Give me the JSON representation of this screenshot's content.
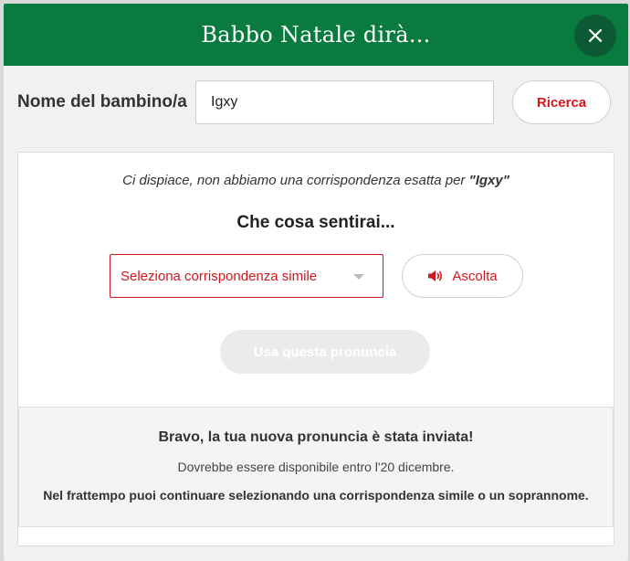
{
  "header": {
    "title": "Babbo Natale dirà...",
    "close_icon": "×"
  },
  "name_row": {
    "label": "Nome del bambino/a",
    "value": "Igxy",
    "search_label": "Ricerca"
  },
  "result": {
    "sorry_prefix": "Ci dispiace, non abbiamo una corrispondenza esatta per ",
    "sorry_name": "\"Igxy\"",
    "what_title": "Che cosa sentirai...",
    "select_placeholder": "Seleziona corrispondenza simile",
    "listen_label": "Ascolta",
    "use_label": "Usa questa pronuncia"
  },
  "notice": {
    "title": "Bravo, la tua nuova pronuncia è stata inviata!",
    "text": "Dovrebbe essere disponibile entro l'20 dicembre.",
    "bold_text": "Nel frattempo puoi continuare selezionando una corrispondenza simile o un soprannome."
  },
  "colors": {
    "header_green": "#0a7b3e",
    "close_bg": "#0b5a33",
    "accent_red": "#d0161f",
    "disabled_button": "#ebebeb"
  }
}
